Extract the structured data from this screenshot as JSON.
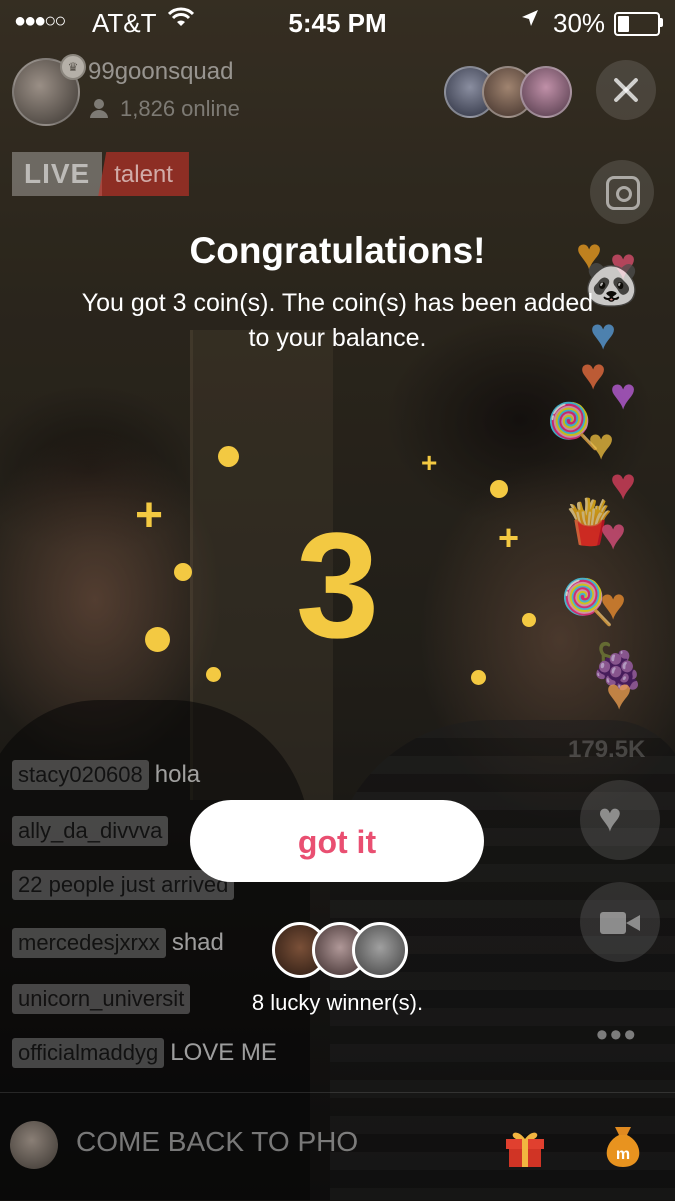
{
  "status_bar": {
    "signal": "●●●○○",
    "carrier": "AT&T",
    "time": "5:45 PM",
    "battery": "30%",
    "battery_level": 0.3
  },
  "host": {
    "name": "99goonsquad",
    "online": "1,826 online"
  },
  "badge": {
    "live": "LIVE",
    "category": "talent"
  },
  "popup": {
    "title": "Congratulations!",
    "message": "You got 3 coin(s). The coin(s) has been added to your balance.",
    "amount": "3",
    "button": "got it",
    "winners_text": "8 lucky winner(s)."
  },
  "like_count": "179.5K",
  "chat": [
    {
      "user": "stacy020608",
      "msg": "hola"
    },
    {
      "user": "ally_da_divvva",
      "msg": ""
    },
    {
      "user": "22 people just arrived",
      "msg": ""
    },
    {
      "user": "mercedesjxrxx",
      "msg": "shad"
    },
    {
      "user": "unicorn_universit",
      "msg": ""
    },
    {
      "user": "officialmaddyg",
      "msg": "LOVE ME"
    }
  ],
  "comment_input": {
    "value": "COME BACK TO PHO"
  },
  "more_label": "•••",
  "colors": {
    "accent_gold": "#f3c942",
    "button_text": "#e94f71",
    "live_red": "#cd3228"
  },
  "icons": [
    "wifi-icon",
    "location-arrow-icon",
    "battery-icon",
    "person-icon",
    "close-icon",
    "instagram-icon",
    "heart-icon",
    "video-camera-icon",
    "more-icon",
    "gift-icon",
    "coin-bag-icon"
  ]
}
